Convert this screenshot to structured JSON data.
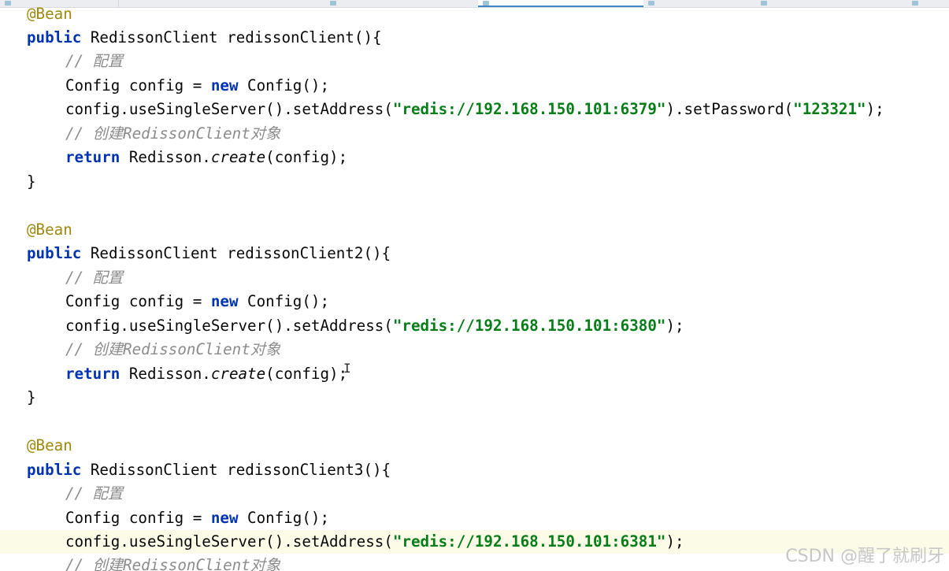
{
  "tabs": [
    {
      "active": false
    },
    {
      "active": false
    },
    {
      "active": true
    },
    {
      "active": false
    },
    {
      "active": false
    },
    {
      "active": false
    }
  ],
  "code": {
    "annotation": "@Bean",
    "kw_public": "public",
    "kw_new": "new",
    "kw_return": "return",
    "type_name": "RedissonClient",
    "comment_config": "// 配置",
    "comment_create": "// 创建RedissonClient对象",
    "config_decl_head": "Config config = ",
    "config_decl_tail": " Config();",
    "use_single_server": "config.useSingleServer().setAddress(",
    "set_password_call": ").setPassword(",
    "stmt_end": ");",
    "return_head": "Redisson.",
    "return_method": "create",
    "return_tail": "(config);",
    "return_tail_cursor_a": "(config",
    "return_tail_cursor_b": ");",
    "close_brace": "}",
    "methods": [
      {
        "signature": "redissonClient(){",
        "address": "\"redis://192.168.150.101:6379\"",
        "password": "\"123321\""
      },
      {
        "signature": "redissonClient2(){",
        "address": "\"redis://192.168.150.101:6380\""
      },
      {
        "signature": "redissonClient3(){",
        "address": "\"redis://192.168.150.101:6381\""
      }
    ]
  },
  "watermark": "CSDN @醒了就刷牙",
  "colors": {
    "keyword": "#0033b3",
    "annotation": "#9e880d",
    "string": "#067d17",
    "comment": "#8c8c8c",
    "active_tab_underline": "#4083c9"
  }
}
